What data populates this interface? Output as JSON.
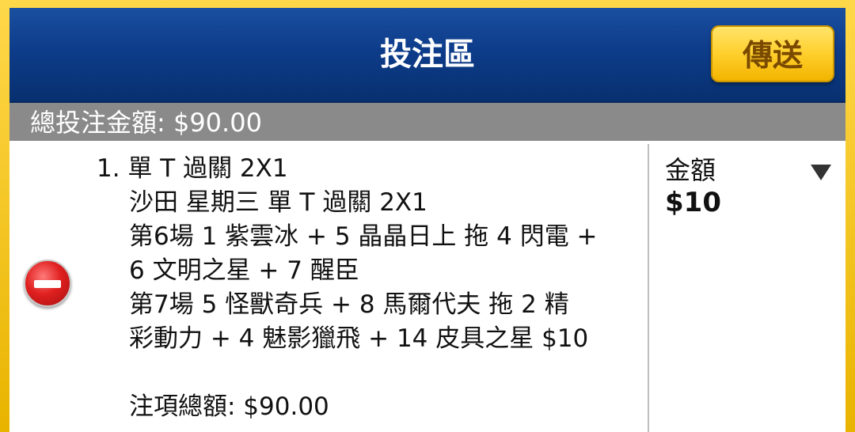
{
  "header": {
    "title": "投注區",
    "send_label": "傳送"
  },
  "summary": {
    "total_text": "總投注金額: $90.00"
  },
  "bet": {
    "lines": [
      "1. 單 T 過關 2X1",
      "沙田 星期三 單 T 過關 2X1",
      "第6場  1 紫雲冰 +  5 晶晶日上 拖  4 閃電 +",
      "6 文明之星 +  7 醒臣",
      "第7場  5 怪獸奇兵 +  8 馬爾代夫 拖  2 精",
      "彩動力 +  4 魅影獵飛 +  14 皮具之星 $10",
      "",
      "注項總額: $90.00"
    ],
    "amount_label": "金額",
    "amount_value": "$10"
  },
  "icons": {
    "remove": "minus-circle-icon",
    "dropdown": "triangle-down-icon"
  },
  "colors": {
    "header_blue": "#0d3c8a",
    "frame_yellow": "#f5c400",
    "summary_gray": "#8a8a8a",
    "remove_red": "#e02020"
  }
}
